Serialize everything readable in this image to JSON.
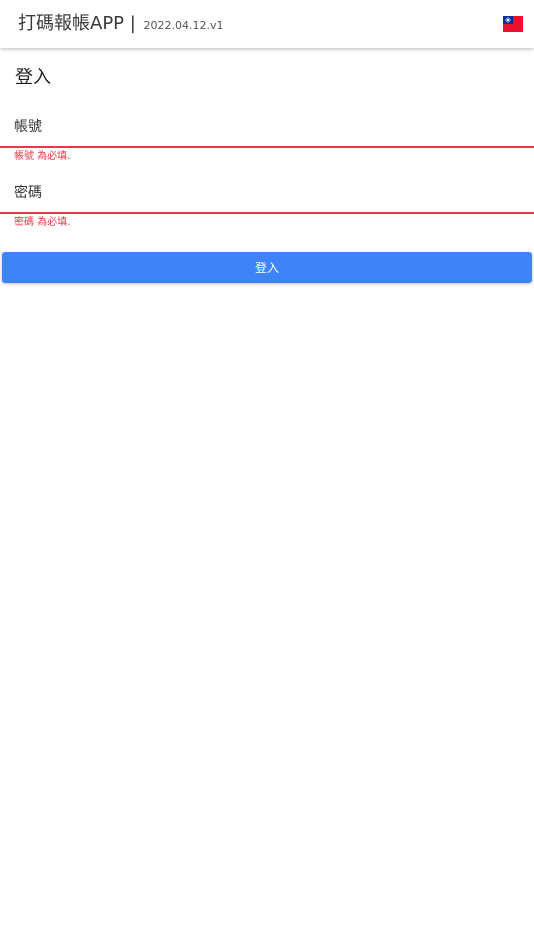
{
  "header": {
    "app_name": "打碼報帳APP |",
    "version": "2022.04.12.v1",
    "language_flag_icon": "taiwan-flag-icon"
  },
  "page": {
    "title": "登入"
  },
  "form": {
    "account": {
      "placeholder": "帳號",
      "value": "",
      "error": "帳號 為必填."
    },
    "password": {
      "placeholder": "密碼",
      "value": "",
      "error": "密碼 為必填."
    },
    "submit_label": "登入"
  },
  "colors": {
    "accent": "#3f83f8",
    "error": "#e53946"
  }
}
